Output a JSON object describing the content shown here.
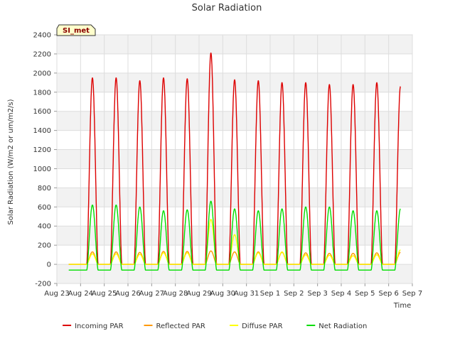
{
  "chart_data": {
    "type": "line",
    "title": "Solar Radiation",
    "xlabel": "Time",
    "ylabel": "Solar Radiation (W/m2 or um/m2/s)",
    "station_label": "SI_met",
    "ylim": [
      -200,
      2400
    ],
    "yticks": [
      -200,
      0,
      200,
      400,
      600,
      800,
      1000,
      1200,
      1400,
      1600,
      1800,
      2000,
      2200,
      2400
    ],
    "xlim": [
      "2023-08-23",
      "2023-09-07"
    ],
    "xticks": [
      "Aug 23",
      "Aug 24",
      "Aug 25",
      "Aug 26",
      "Aug 27",
      "Aug 28",
      "Aug 29",
      "Aug 30",
      "Aug 31",
      "Sep 1",
      "Sep 2",
      "Sep 3",
      "Sep 4",
      "Sep 5",
      "Sep 6",
      "Sep 7"
    ],
    "data_start": "2023-08-23 12:00",
    "data_end": "2023-09-06 12:00",
    "grid": true,
    "legend_position": "bottom",
    "days": [
      "2023-08-24",
      "2023-08-25",
      "2023-08-26",
      "2023-08-27",
      "2023-08-28",
      "2023-08-29",
      "2023-08-30",
      "2023-08-31",
      "2023-09-01",
      "2023-09-02",
      "2023-09-03",
      "2023-09-04",
      "2023-09-05",
      "2023-09-06"
    ],
    "series": [
      {
        "name": "Incoming PAR",
        "color": "#dd0000",
        "night_value": 0,
        "daily_peak": [
          1950,
          1950,
          1920,
          1950,
          1940,
          2210,
          1930,
          1920,
          1900,
          1900,
          1880,
          1880,
          1900,
          1860
        ]
      },
      {
        "name": "Reflected PAR",
        "color": "#ff9900",
        "night_value": 0,
        "daily_peak": [
          130,
          130,
          125,
          135,
          135,
          140,
          130,
          130,
          125,
          120,
          115,
          115,
          120,
          125
        ]
      },
      {
        "name": "Diffuse PAR",
        "color": "#ffff00",
        "night_value": 0,
        "daily_peak": [
          110,
          110,
          105,
          120,
          120,
          470,
          310,
          120,
          130,
          100,
          95,
          90,
          100,
          150
        ]
      },
      {
        "name": "Net Radiation",
        "color": "#00dd00",
        "night_value": -60,
        "daily_peak": [
          620,
          620,
          600,
          560,
          570,
          660,
          580,
          560,
          580,
          600,
          600,
          560,
          560,
          580
        ]
      }
    ]
  }
}
